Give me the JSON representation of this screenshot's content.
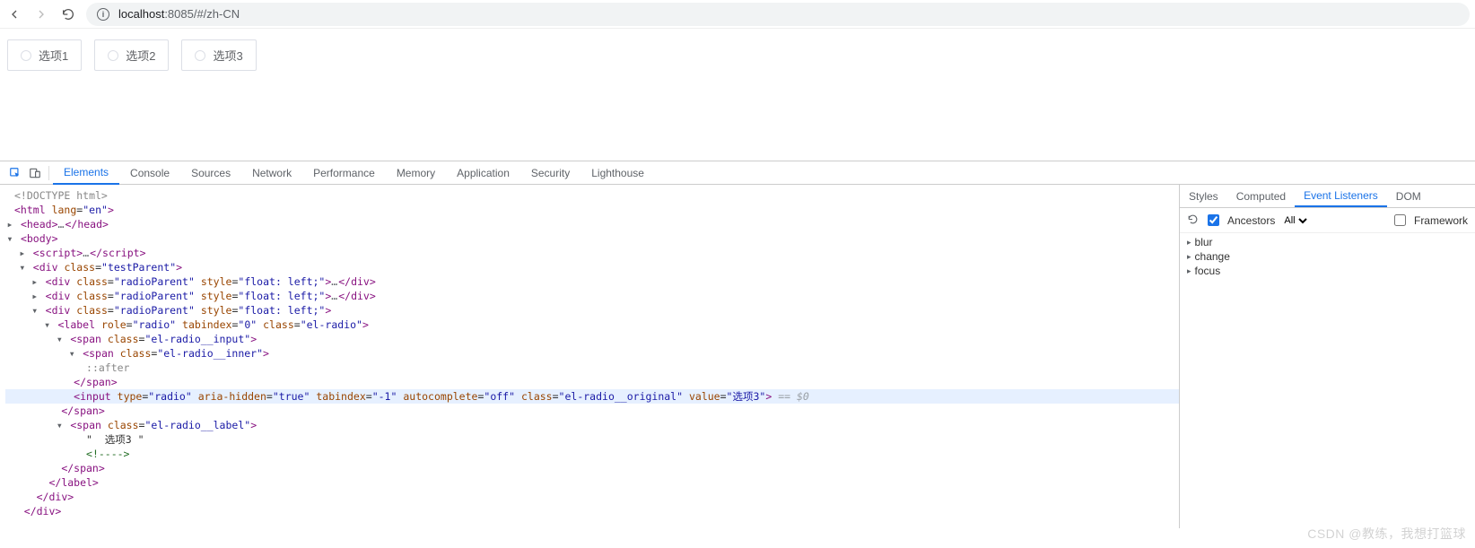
{
  "chrome": {
    "url_host": "localhost",
    "url_rest": ":8085/#/zh-CN"
  },
  "radios": {
    "items": [
      "选项1",
      "选项2",
      "选项3"
    ]
  },
  "devtools": {
    "tabs": [
      "Elements",
      "Console",
      "Sources",
      "Network",
      "Performance",
      "Memory",
      "Application",
      "Security",
      "Lighthouse"
    ],
    "active_tab": "Elements"
  },
  "side": {
    "tabs": [
      "Styles",
      "Computed",
      "Event Listeners",
      "DOM"
    ],
    "active_tab": "Event Listeners",
    "ancestors_label": "Ancestors",
    "filter_all": "All",
    "framework_label": "Framework",
    "events": [
      "blur",
      "change",
      "focus"
    ]
  },
  "dom": {
    "doctype": "<!DOCTYPE html>",
    "html_open": {
      "attr": "lang",
      "val": "en"
    },
    "head": "head",
    "body": "body",
    "script": "script",
    "testParent": {
      "attr": "class",
      "val": "testParent"
    },
    "radioParent": {
      "attr": "class",
      "val": "radioParent",
      "style_attr": "style",
      "style_val": "float: left;"
    },
    "label": {
      "role_attr": "role",
      "role_val": "radio",
      "tab_attr": "tabindex",
      "tab_val": "0",
      "class_attr": "class",
      "class_val": "el-radio"
    },
    "span_input": {
      "attr": "class",
      "val": "el-radio__input"
    },
    "span_inner": {
      "attr": "class",
      "val": "el-radio__inner"
    },
    "after": "::after",
    "input": {
      "type_attr": "type",
      "type_val": "radio",
      "aria_attr": "aria-hidden",
      "aria_val": "true",
      "tab_attr": "tabindex",
      "tab_val": "-1",
      "auto_attr": "autocomplete",
      "auto_val": "off",
      "class_attr": "class",
      "class_val": "el-radio__original",
      "value_attr": "value",
      "value_val": "选项3",
      "eqdollar": " == $0"
    },
    "span_label": {
      "attr": "class",
      "val": "el-radio__label"
    },
    "label_text": "\"  选项3 \"",
    "comment": "<!---->"
  },
  "watermark": "CSDN @教练，我想打篮球"
}
